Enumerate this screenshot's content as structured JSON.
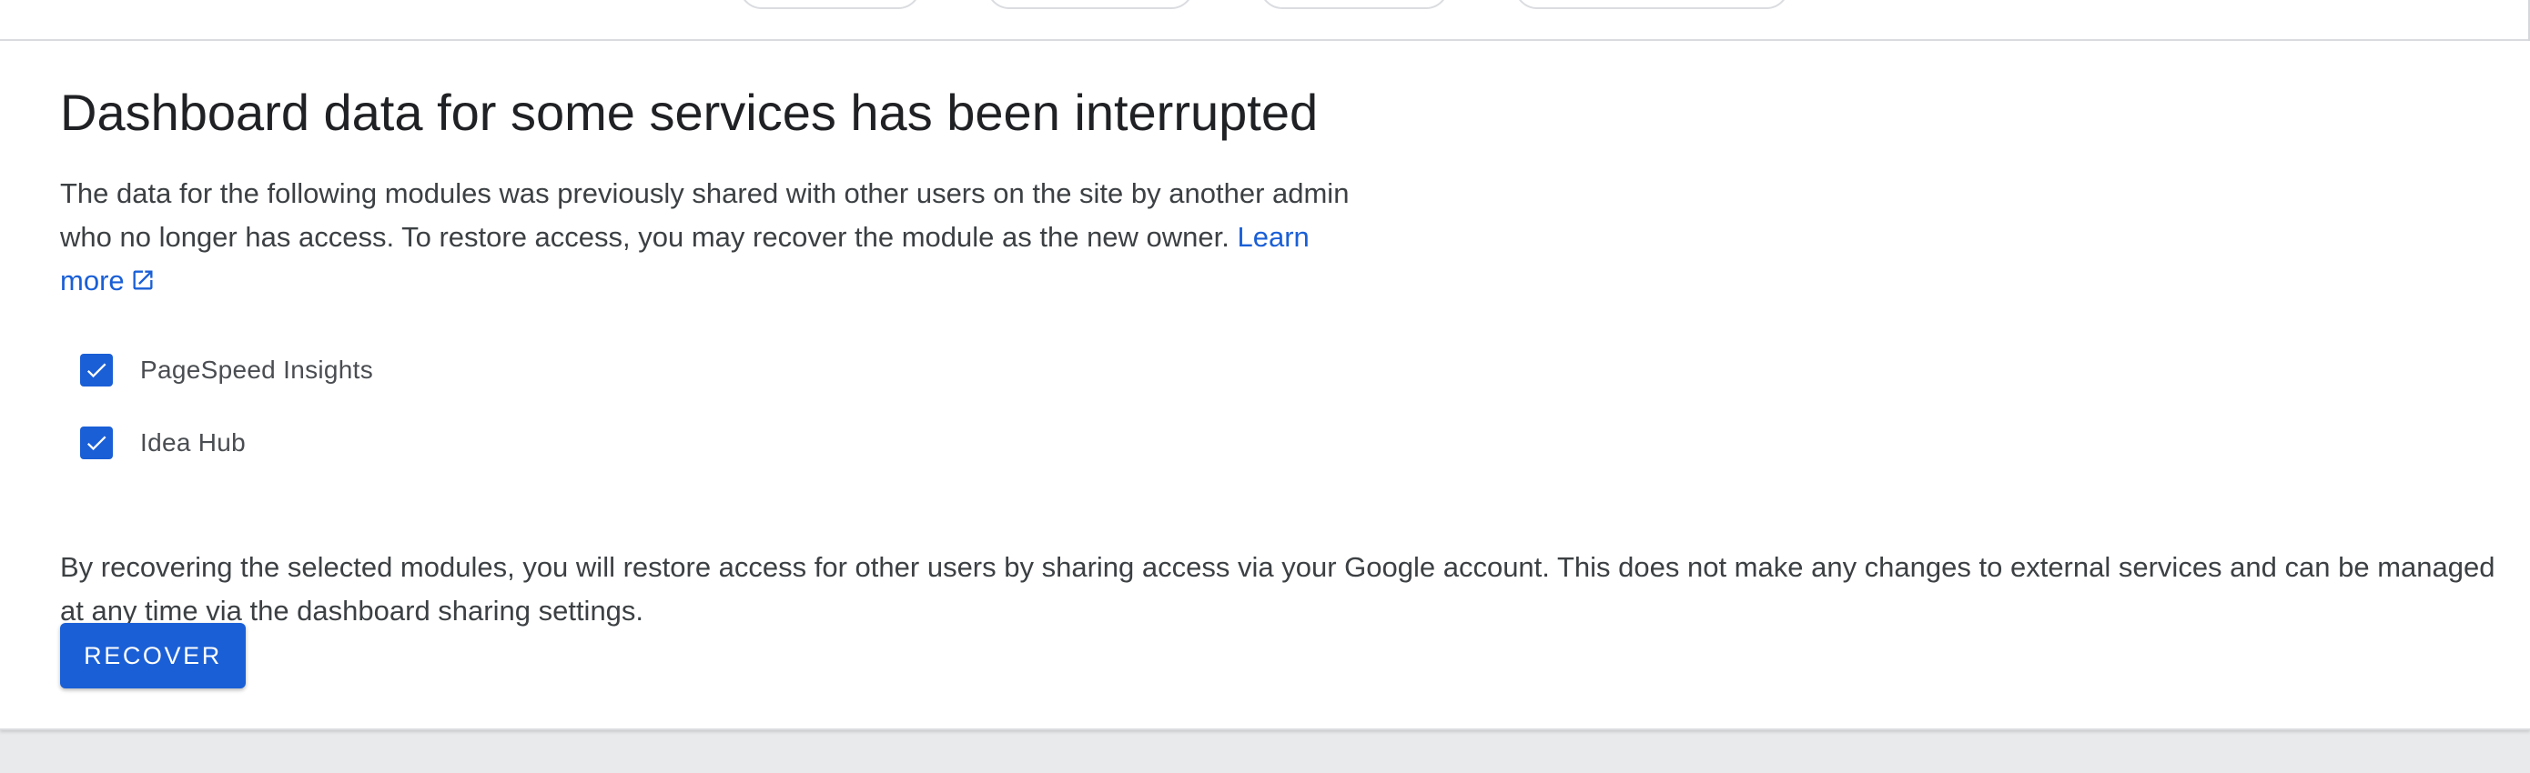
{
  "dialog": {
    "title": "Dashboard data for some services has been interrupted",
    "description": "The data for the following modules was previously shared with other users on the site by another admin who no longer has access. To restore access, you may recover the module as the new owner.",
    "learn_more_label": "Learn more",
    "modules": [
      {
        "label": "PageSpeed Insights",
        "checked": true
      },
      {
        "label": "Idea Hub",
        "checked": true
      }
    ],
    "notice": "By recovering the selected modules, you will restore access for other users by sharing access via your Google account. This does not make any changes to external services and can be managed at any time via the dashboard sharing settings.",
    "recover_label": "RECOVER"
  },
  "icons": {
    "learn_more": "external-link-icon",
    "checkbox": "checkmark-icon"
  },
  "colors": {
    "accent": "#1a5fd6",
    "title_text": "#202124",
    "body_text": "#3c4043",
    "page_background": "#e9eaeb",
    "card_background": "#ffffff"
  }
}
